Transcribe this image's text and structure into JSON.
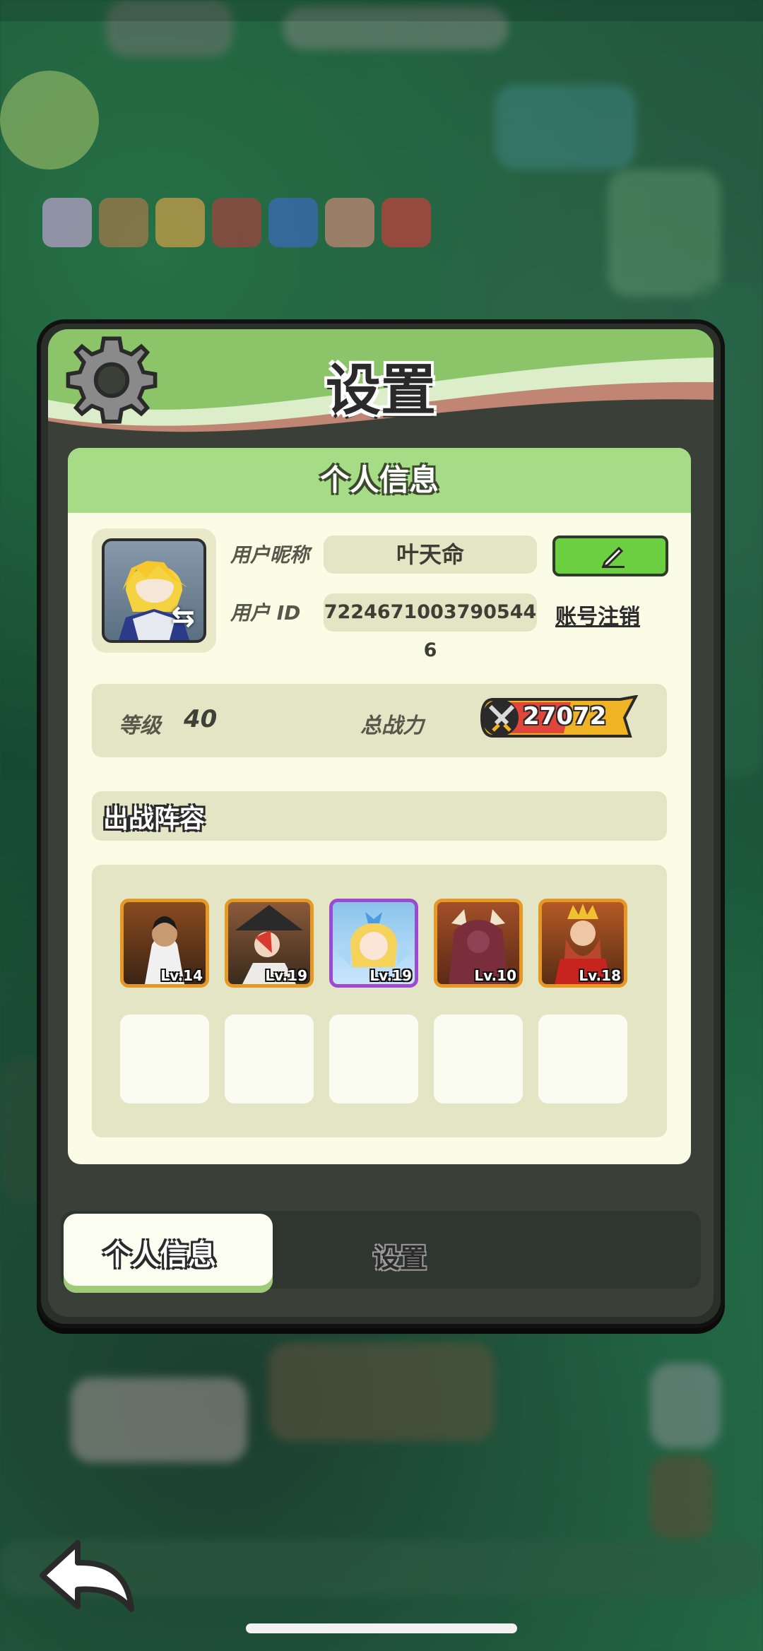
{
  "modal": {
    "title": "设置",
    "panel_title": "个人信息",
    "profile": {
      "nickname_label": "用户昵称",
      "nickname_value": "叶天命",
      "id_label": "用户 ID",
      "id_value": "7224671003790544​6",
      "logout_label": "账号注销"
    },
    "stats": {
      "level_label": "等级",
      "level_value": "40",
      "power_label": "总战力",
      "power_value": "27072"
    },
    "lineup": {
      "title": "出战阵容",
      "heroes": [
        {
          "level": "Lv.14"
        },
        {
          "level": "Lv.19"
        },
        {
          "level": "Lv.19"
        },
        {
          "level": "Lv.10"
        },
        {
          "level": "Lv.18"
        }
      ],
      "empty_slots": 5
    },
    "tabs": [
      {
        "label": "个人信息",
        "active": true
      },
      {
        "label": "设置",
        "active": false
      }
    ]
  },
  "colors": {
    "header_green": "#8cc46a",
    "panel_bg": "#fafce6",
    "field_bg": "#e4e5c4",
    "edit_button": "#6bcf3f",
    "hero_frame_orange": "#e59823",
    "hero_frame_purple": "#9d49d1"
  },
  "icons": [
    "gear-icon",
    "pencil-icon",
    "swap-icon",
    "sword-icon",
    "back-arrow-icon"
  ]
}
